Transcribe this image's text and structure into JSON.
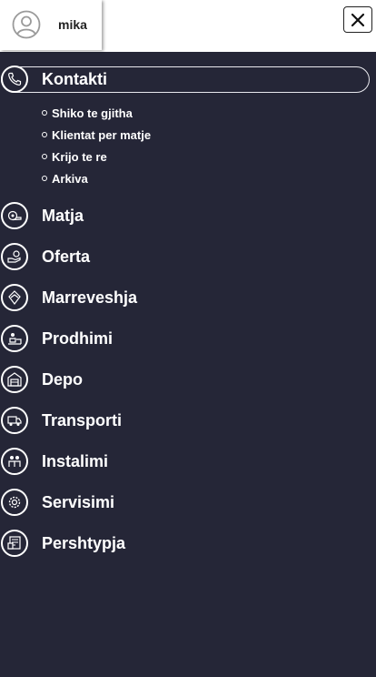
{
  "header": {
    "username": "mika",
    "avatar_icon": "user-circle-icon",
    "close_icon": "close-icon"
  },
  "menu": {
    "active": "Kontakti",
    "items": [
      {
        "label": "Kontakti",
        "icon": "phone-icon"
      },
      {
        "label": "Matja",
        "icon": "measuring-tape-icon"
      },
      {
        "label": "Oferta",
        "icon": "offer-hand-icon"
      },
      {
        "label": "Marreveshja",
        "icon": "agreement-icon"
      },
      {
        "label": "Prodhimi",
        "icon": "production-icon"
      },
      {
        "label": "Depo",
        "icon": "warehouse-icon"
      },
      {
        "label": "Transporti",
        "icon": "truck-icon"
      },
      {
        "label": "Instalimi",
        "icon": "installation-icon"
      },
      {
        "label": "Servisimi",
        "icon": "service-gear-icon"
      },
      {
        "label": "Pershtypja",
        "icon": "feedback-icon"
      }
    ],
    "submenu": [
      {
        "label": "Shiko te gjitha"
      },
      {
        "label": "Klientat per matje"
      },
      {
        "label": "Krijo te re"
      },
      {
        "label": "Arkiva"
      }
    ]
  },
  "colors": {
    "sidebar_bg": "#252637",
    "header_bg": "#ffffff",
    "text": "#ffffff"
  }
}
